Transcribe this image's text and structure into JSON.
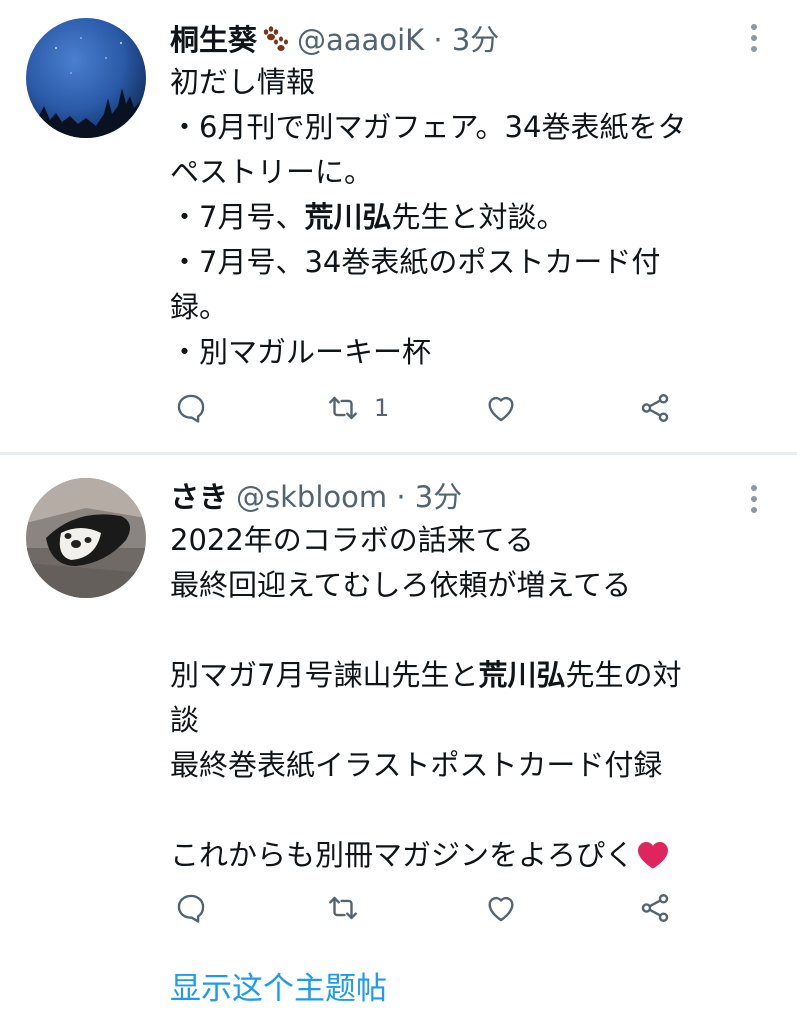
{
  "tweets": [
    {
      "author_name": "桐生葵",
      "author_emoji": "paw-prints-icon",
      "handle": "@aaaoiK",
      "separator": "·",
      "time": "3分",
      "lines": [
        "初だし情報",
        "・6月刊で別マガフェア。34巻表紙をタ",
        "ペストリーに。",
        "・7月号、荒川弘先生と対談。",
        "・7月号、34巻表紙のポストカード付",
        "録。",
        "・別マガルーキー杯"
      ],
      "retweet_count": "1"
    },
    {
      "author_name": "さき",
      "handle": "@skbloom",
      "separator": "·",
      "time": "3分",
      "lines": [
        "2022年のコラボの話来てる",
        "最終回迎えてむしろ依頼が増えてる",
        "",
        "別マガ7月号諫山先生と荒川弘先生の対",
        "談",
        "最終巻表紙イラストポストカード付録",
        "",
        "これからも別冊マガジンをよろぴく"
      ],
      "retweet_count": ""
    }
  ],
  "show_thread_label": "显示这个主题帖",
  "colors": {
    "link": "#1d9bf0",
    "secondary": "#536471",
    "heart": "#e0245e"
  }
}
